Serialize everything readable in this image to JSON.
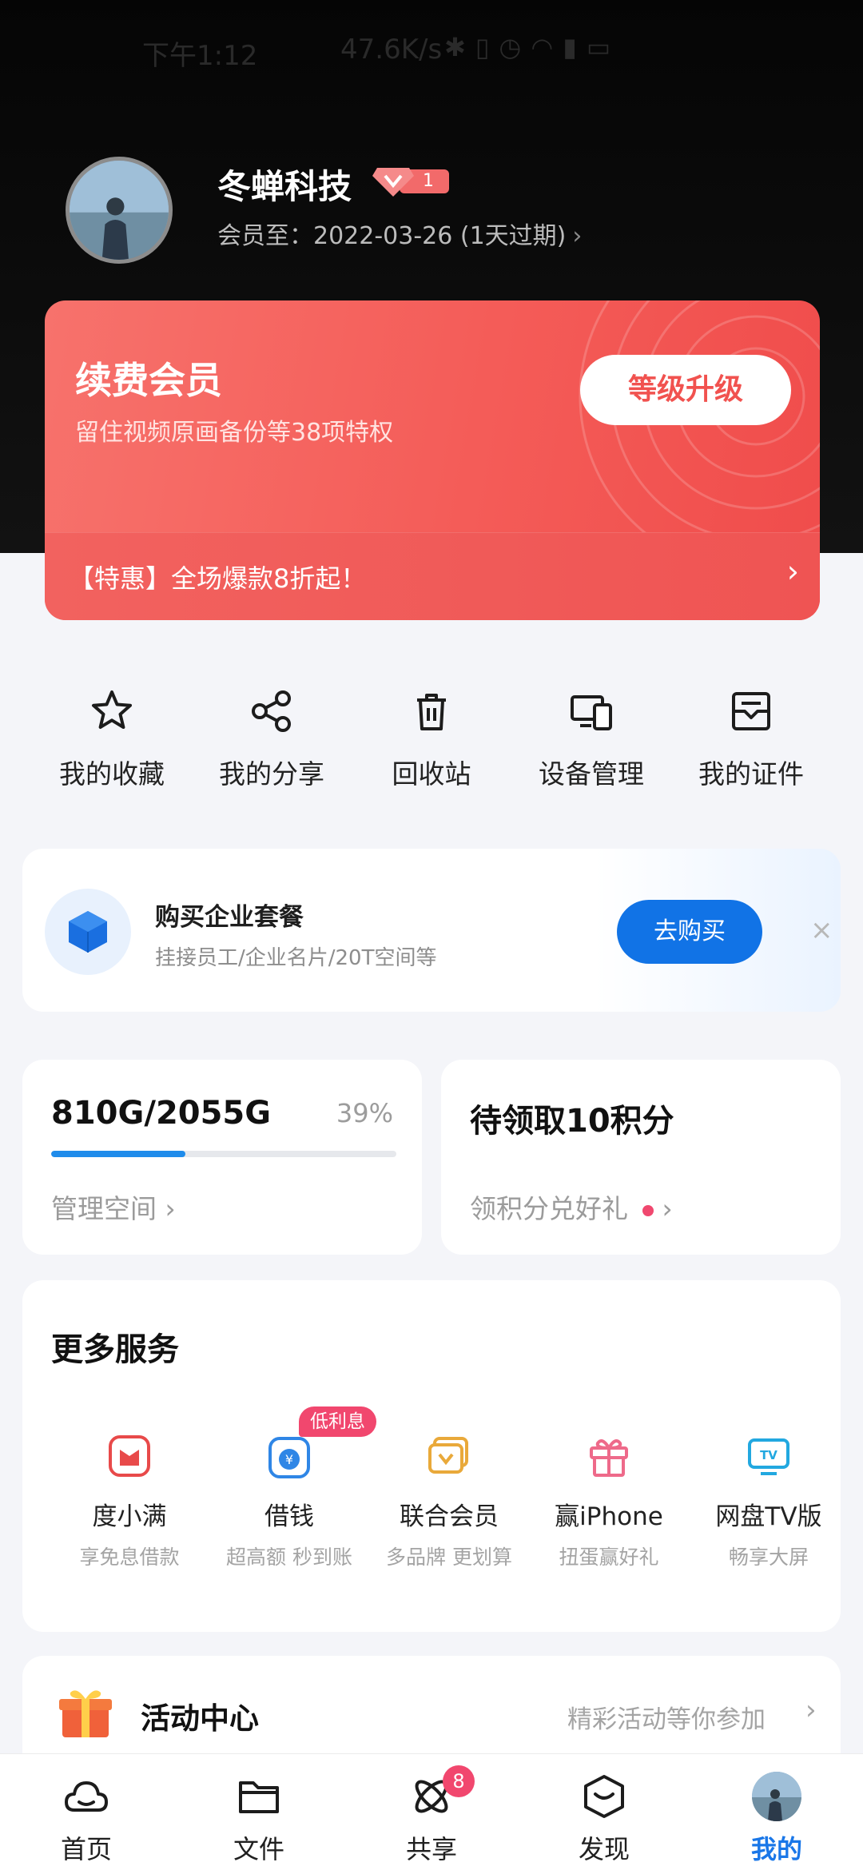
{
  "status_bar": {
    "time": "下午1:12",
    "speed": "47.6K/s",
    "icons": [
      "bluetooth-icon",
      "vibrate-icon",
      "alarm-icon",
      "wifi-icon",
      "signal-icon",
      "battery-icon"
    ]
  },
  "profile": {
    "name": "冬蝉科技",
    "vip_level": "1",
    "member_until": "会员至：2022-03-26 (1天过期)"
  },
  "vip_card": {
    "title": "续费会员",
    "subtitle": "留住视频原画备份等38项特权",
    "upgrade_label": "等级升级",
    "promo": "【特惠】全场爆款8折起！"
  },
  "quick_actions": [
    {
      "label": "我的收藏",
      "icon": "star-icon"
    },
    {
      "label": "我的分享",
      "icon": "share-icon"
    },
    {
      "label": "回收站",
      "icon": "trash-icon"
    },
    {
      "label": "设备管理",
      "icon": "devices-icon"
    },
    {
      "label": "我的证件",
      "icon": "id-card-icon"
    }
  ],
  "enterprise": {
    "title": "购买企业套餐",
    "subtitle": "挂接员工/企业名片/20T空间等",
    "button": "去购买",
    "close": "×"
  },
  "storage": {
    "used": "810G/2055G",
    "percent_label": "39%",
    "percent": 39,
    "link": "管理空间"
  },
  "points": {
    "title": "待领取10积分",
    "link": "领积分兑好礼"
  },
  "services": {
    "title": "更多服务",
    "items": [
      {
        "name": "度小满",
        "desc": "享免息借款",
        "icon": "duxiaoman-icon",
        "color": "#e84a4a"
      },
      {
        "name": "借钱",
        "desc": "超高额 秒到账",
        "icon": "money-bag-icon",
        "color": "#2f86e6",
        "tag": "低利息"
      },
      {
        "name": "联合会员",
        "desc": "多品牌 更划算",
        "icon": "vip-card-icon",
        "color": "#e9a93a"
      },
      {
        "name": "赢iPhone",
        "desc": "扭蛋赢好礼",
        "icon": "gift-icon",
        "color": "#ee6a8a"
      },
      {
        "name": "网盘TV版",
        "desc": "畅享大屏",
        "icon": "tv-icon",
        "color": "#22a8e0"
      }
    ]
  },
  "activity": {
    "title": "活动中心",
    "hint": "精彩活动等你参加"
  },
  "tabs": [
    {
      "label": "首页",
      "icon": "cloud-icon"
    },
    {
      "label": "文件",
      "icon": "folder-icon"
    },
    {
      "label": "共享",
      "icon": "share-atom-icon",
      "badge": "8"
    },
    {
      "label": "发现",
      "icon": "discover-icon"
    },
    {
      "label": "我的",
      "icon": "avatar-icon",
      "active": true
    }
  ],
  "colors": {
    "accent": "#1a77e8",
    "vip_red": "#f45c58",
    "badge_pink": "#f1476e"
  }
}
